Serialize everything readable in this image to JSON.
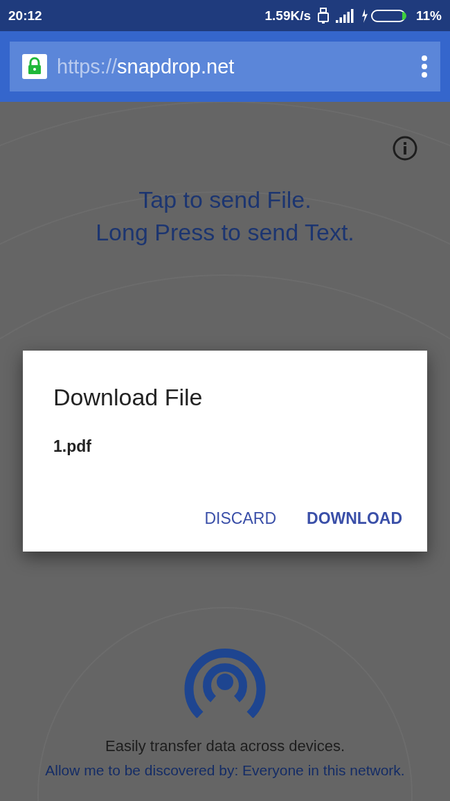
{
  "status_bar": {
    "time": "20:12",
    "speed": "1.59K/s",
    "battery": "11%"
  },
  "address_bar": {
    "scheme": "https://",
    "host": "snapdrop.net"
  },
  "page": {
    "instructions": [
      "Tap to send File.",
      "Long Press to send Text."
    ],
    "tagline": "Easily transfer data across devices.",
    "discovery": "Allow me to be discovered by: Everyone in this network."
  },
  "dialog": {
    "title": "Download File",
    "file_name": "1.pdf",
    "buttons": [
      {
        "label": "DISCARD",
        "primary": false
      },
      {
        "label": "DOWNLOAD",
        "primary": true
      }
    ]
  }
}
